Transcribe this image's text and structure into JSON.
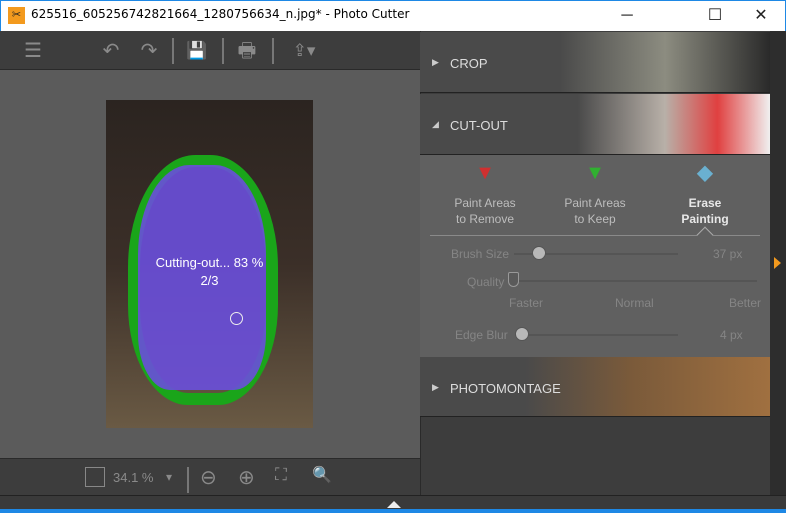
{
  "window": {
    "title": "625516_605256742821664_1280756634_n.jpg* - Photo Cutter",
    "minimize": "─",
    "maximize": "☐",
    "close": "✕"
  },
  "toolbar": {
    "menu": "☰",
    "undo": "↶",
    "redo": "↷",
    "save": "💾",
    "print": "🖶",
    "share": "⇪▾"
  },
  "canvas": {
    "progress_label": "Cutting-out... 83 %",
    "progress_percent": 83,
    "step": "2/3"
  },
  "bottombar": {
    "zoom_value": "34.1 %",
    "zoom_dropdown": "▾",
    "zoom_out": "⊖",
    "zoom_in": "⊕",
    "fit": "⛶",
    "actual": "🔍"
  },
  "panel": {
    "sections": {
      "crop": "CROP",
      "cutout": "CUT-OUT",
      "photomontage": "PHOTOMONTAGE"
    },
    "tools": [
      {
        "line1": "Paint Areas",
        "line2": "to Remove",
        "color": "#d03030"
      },
      {
        "line1": "Paint Areas",
        "line2": "to Keep",
        "color": "#30b030"
      },
      {
        "line1": "Erase",
        "line2": "Painting",
        "color": "#6ab0d0"
      }
    ],
    "brush_size": {
      "label": "Brush Size",
      "value": "37 px"
    },
    "quality": {
      "label": "Quality",
      "options": [
        "Faster",
        "Normal",
        "Better"
      ],
      "selected": "Faster"
    },
    "edge_blur": {
      "label": "Edge Blur",
      "value": "4 px"
    }
  }
}
